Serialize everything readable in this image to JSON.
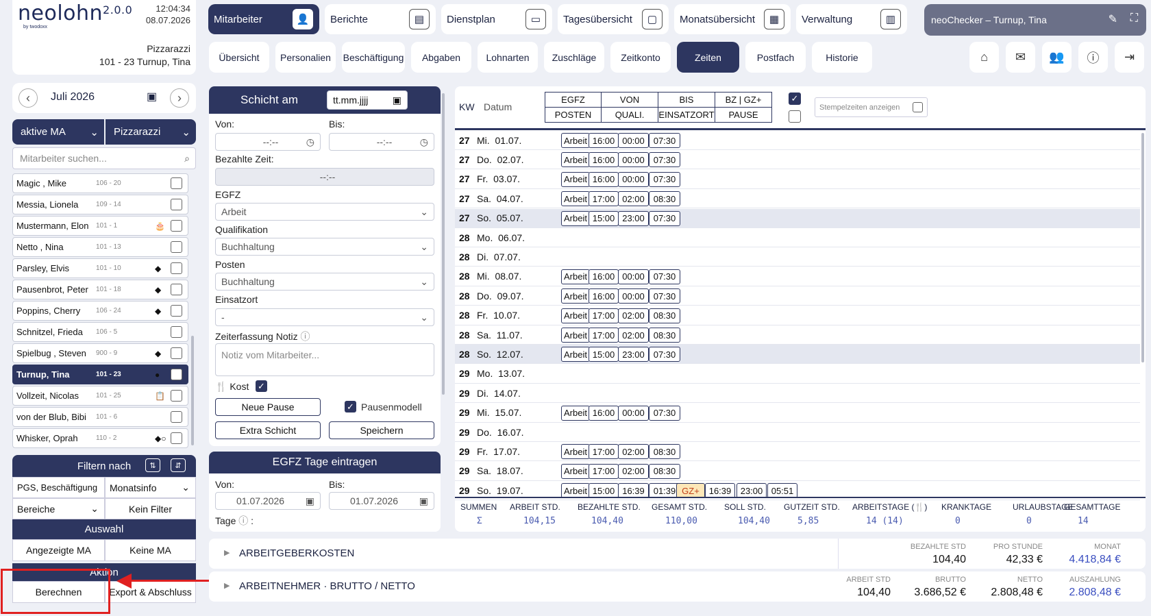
{
  "app": {
    "logo": "neolohn",
    "version": "2.0.0",
    "byline": "by twodoxx",
    "time": "12:04:34",
    "date": "08.07.2026",
    "company": "Pizzarazzi",
    "employee_header": "101 - 23 Turnup, Tina"
  },
  "nav": [
    {
      "label": "Mitarbeiter",
      "icon": "add-user-icon"
    },
    {
      "label": "Berichte",
      "icon": "report-icon"
    },
    {
      "label": "Dienstplan",
      "icon": "schedule-icon"
    },
    {
      "label": "Tagesübersicht",
      "icon": "day-icon"
    },
    {
      "label": "Monatsübersicht",
      "icon": "calendar-icon"
    },
    {
      "label": "Verwaltung",
      "icon": "building-icon"
    }
  ],
  "checker": {
    "label": "neoChecker – Turnup, Tina"
  },
  "tabs": [
    "Übersicht",
    "Personalien",
    "Beschäftigung",
    "Abgaben",
    "Lohnarten",
    "Zuschläge",
    "Zeitkonto",
    "Zeiten",
    "Postfach",
    "Historie"
  ],
  "sidebar": {
    "month": "Juli 2026",
    "filter_status": "aktive MA",
    "filter_company": "Pizzarazzi",
    "search_placeholder": "Mitarbeiter suchen...",
    "employees": [
      {
        "name": "Magic , Mike",
        "num": "106 - 20",
        "mark": ""
      },
      {
        "name": "Messia, Lionela",
        "num": "109 - 14",
        "mark": ""
      },
      {
        "name": "Mustermann, Elon",
        "num": "101 - 1",
        "mark": "🎂"
      },
      {
        "name": "Netto , Nina",
        "num": "101 - 13",
        "mark": ""
      },
      {
        "name": "Parsley, Elvis",
        "num": "101 - 10",
        "mark": "◆"
      },
      {
        "name": "Pausenbrot, Peter",
        "num": "101 - 18",
        "mark": "◆"
      },
      {
        "name": "Poppins, Cherry",
        "num": "106 - 24",
        "mark": "◆"
      },
      {
        "name": "Schnitzel, Frieda",
        "num": "106 - 5",
        "mark": ""
      },
      {
        "name": "Spielbug , Steven",
        "num": "900 - 9",
        "mark": "◆"
      },
      {
        "name": "Turnup, Tina",
        "num": "101 - 23",
        "mark": "●"
      },
      {
        "name": "Vollzeit, Nicolas",
        "num": "101 - 25",
        "mark": "📋"
      },
      {
        "name": "von der Blub, Bibi",
        "num": "101 - 6",
        "mark": ""
      },
      {
        "name": "Whisker, Oprah",
        "num": "110 - 2",
        "mark": "◆○"
      }
    ],
    "filter_header": "Filtern nach",
    "filter1": "PGS, Beschäftigung",
    "filter2": "Monatsinfo",
    "filter3": "Bereiche",
    "filter4": "Kein Filter",
    "selection_header": "Auswahl",
    "sel_shown": "Angezeigte MA",
    "sel_none": "Keine MA",
    "action_header": "Aktion",
    "action_calc": "Berechnen",
    "action_export": "Export & Abschluss"
  },
  "form": {
    "title": "Schicht am",
    "date_placeholder": "tt.mm.jjjj",
    "from_label": "Von:",
    "to_label": "Bis:",
    "time_placeholder": "--:--",
    "paid_label": "Bezahlte Zeit:",
    "paid_value": "--:--",
    "egfz_label": "EGFZ",
    "egfz_value": "Arbeit",
    "qual_label": "Qualifikation",
    "qual_value": "Buchhaltung",
    "post_label": "Posten",
    "post_value": "Buchhaltung",
    "loc_label": "Einsatzort",
    "loc_value": "-",
    "note_label": "Zeiterfassung Notiz",
    "note_placeholder": "Notiz vom Mitarbeiter...",
    "kost": "Kost",
    "new_break": "Neue Pause",
    "break_model": "Pausenmodell",
    "extra_shift": "Extra Schicht",
    "save": "Speichern",
    "egfz_days_title": "EGFZ Tage eintragen",
    "days_from": "01.07.2026",
    "days_to": "01.07.2026",
    "days_label": "Tage"
  },
  "grid": {
    "kw": "KW",
    "datum": "Datum",
    "h": [
      "EGFZ",
      "VON",
      "BIS",
      "BZ | GZ+",
      "POSTEN",
      "QUALI.",
      "EINSATZORT",
      "PAUSE"
    ],
    "stamp_label": "Stempelzeiten anzeigen",
    "rows": [
      {
        "kw": "27",
        "day": "Mi.",
        "date": "01.07.",
        "tags": [
          "Arbeit",
          "16:00",
          "00:00",
          "07:30"
        ],
        "hl": false
      },
      {
        "kw": "27",
        "day": "Do.",
        "date": "02.07.",
        "tags": [
          "Arbeit",
          "16:00",
          "00:00",
          "07:30"
        ],
        "hl": false
      },
      {
        "kw": "27",
        "day": "Fr.",
        "date": "03.07.",
        "tags": [
          "Arbeit",
          "16:00",
          "00:00",
          "07:30"
        ],
        "hl": false
      },
      {
        "kw": "27",
        "day": "Sa.",
        "date": "04.07.",
        "tags": [
          "Arbeit",
          "17:00",
          "02:00",
          "08:30"
        ],
        "hl": false
      },
      {
        "kw": "27",
        "day": "So.",
        "date": "05.07.",
        "tags": [
          "Arbeit",
          "15:00",
          "23:00",
          "07:30"
        ],
        "hl": true
      },
      {
        "kw": "28",
        "day": "Mo.",
        "date": "06.07.",
        "tags": [],
        "hl": false
      },
      {
        "kw": "28",
        "day": "Di.",
        "date": "07.07.",
        "tags": [],
        "hl": false
      },
      {
        "kw": "28",
        "day": "Mi.",
        "date": "08.07.",
        "tags": [
          "Arbeit",
          "16:00",
          "00:00",
          "07:30"
        ],
        "hl": false
      },
      {
        "kw": "28",
        "day": "Do.",
        "date": "09.07.",
        "tags": [
          "Arbeit",
          "16:00",
          "00:00",
          "07:30"
        ],
        "hl": false
      },
      {
        "kw": "28",
        "day": "Fr.",
        "date": "10.07.",
        "tags": [
          "Arbeit",
          "17:00",
          "02:00",
          "08:30"
        ],
        "hl": false
      },
      {
        "kw": "28",
        "day": "Sa.",
        "date": "11.07.",
        "tags": [
          "Arbeit",
          "17:00",
          "02:00",
          "08:30"
        ],
        "hl": false
      },
      {
        "kw": "28",
        "day": "So.",
        "date": "12.07.",
        "tags": [
          "Arbeit",
          "15:00",
          "23:00",
          "07:30"
        ],
        "hl": true
      },
      {
        "kw": "29",
        "day": "Mo.",
        "date": "13.07.",
        "tags": [],
        "hl": false
      },
      {
        "kw": "29",
        "day": "Di.",
        "date": "14.07.",
        "tags": [],
        "hl": false
      },
      {
        "kw": "29",
        "day": "Mi.",
        "date": "15.07.",
        "tags": [
          "Arbeit",
          "16:00",
          "00:00",
          "07:30"
        ],
        "hl": false
      },
      {
        "kw": "29",
        "day": "Do.",
        "date": "16.07.",
        "tags": [],
        "hl": false
      },
      {
        "kw": "29",
        "day": "Fr.",
        "date": "17.07.",
        "tags": [
          "Arbeit",
          "17:00",
          "02:00",
          "08:30"
        ],
        "hl": false
      },
      {
        "kw": "29",
        "day": "Sa.",
        "date": "18.07.",
        "tags": [
          "Arbeit",
          "17:00",
          "02:00",
          "08:30"
        ],
        "hl": false
      },
      {
        "kw": "29",
        "day": "So.",
        "date": "19.07.",
        "tags": [
          "Arbeit",
          "15:00",
          "16:39",
          "01:39"
        ],
        "extra": [
          "GZ+",
          "16:39",
          "23:00",
          "05:51"
        ],
        "hl": false
      }
    ],
    "sums": [
      {
        "label": "SUMMEN",
        "value": "Σ"
      },
      {
        "label": "ARBEIT STD.",
        "value": "104,15"
      },
      {
        "label": "BEZAHLTE STD.",
        "value": "104,40"
      },
      {
        "label": "GESAMT STD.",
        "value": "110,00"
      },
      {
        "label": "SOLL STD.",
        "value": "104,40"
      },
      {
        "label": "GUTZEIT STD.",
        "value": "5,85"
      },
      {
        "label": "ARBEITSTAGE (🍴)",
        "value": "14 (14)"
      },
      {
        "label": "KRANKTAGE",
        "value": "0"
      },
      {
        "label": "URLAUBSTAGE",
        "value": "0"
      },
      {
        "label": "GESAMTTAGE",
        "value": "14"
      }
    ]
  },
  "costs": {
    "employer": {
      "title": "ARBEITGEBERKOSTEN",
      "c1l": "BEZAHLTE STD",
      "c1v": "104,40",
      "c2l": "PRO STUNDE",
      "c2v": "42,33 €",
      "c3l": "MONAT",
      "c3v": "4.418,84 €"
    },
    "employee": {
      "title": "ARBEITNEHMER · BRUTTO / NETTO",
      "c1l": "ARBEIT STD",
      "c1v": "104,40",
      "c2l": "BRUTTO",
      "c2v": "3.686,52 €",
      "c3l": "NETTO",
      "c3v": "2.808,48 €",
      "c4l": "AUSZAHLUNG",
      "c4v": "2.808,48 €"
    }
  },
  "colors": {
    "primary": "#2d3660",
    "accent_blue": "#3a4ec0",
    "highlight_red": "#e02020",
    "gz_bg": "#fde7b8"
  }
}
